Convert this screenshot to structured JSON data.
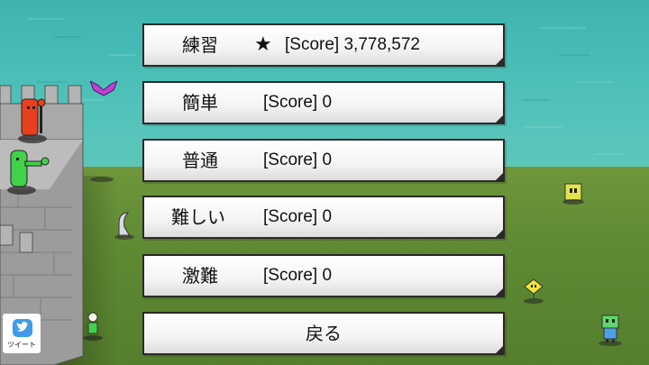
{
  "menu": {
    "items": [
      {
        "label": "練習",
        "star": "★",
        "score": "[Score] 3,778,572"
      },
      {
        "label": "簡単",
        "score": "[Score] 0"
      },
      {
        "label": "普通",
        "score": "[Score] 0"
      },
      {
        "label": "難しい",
        "score": "[Score] 0"
      },
      {
        "label": "激難",
        "score": "[Score] 0"
      }
    ],
    "back_label": "戻る"
  },
  "share": {
    "label": "ツイート",
    "icon": "twitter-bird-icon"
  },
  "colors": {
    "sea": "#48bdb6",
    "grass": "#5f8a33",
    "castle": "#a9a9a9",
    "button_border": "#2a2a2a",
    "tweet_blue": "#3f9be8"
  }
}
